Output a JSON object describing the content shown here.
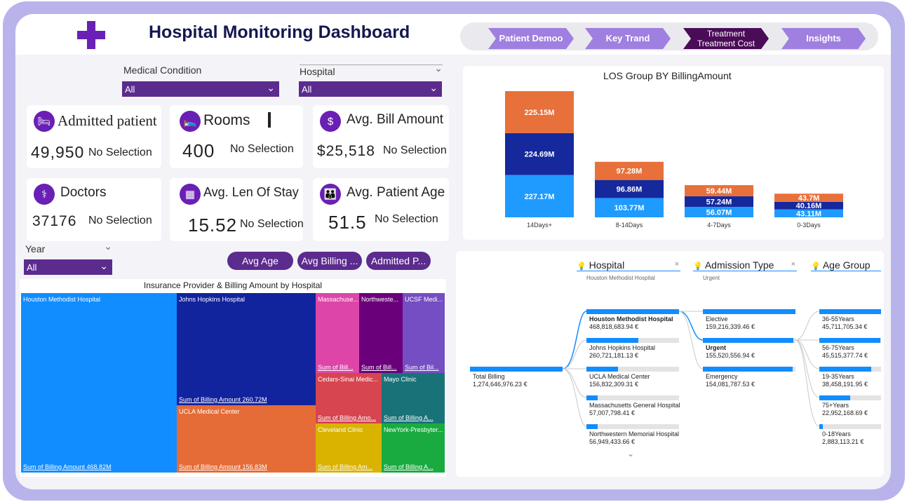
{
  "header": {
    "title": "Hospital Monitoring Dashboard",
    "nav": [
      {
        "label": "Patient Demoo"
      },
      {
        "label": "Key Trand"
      },
      {
        "label": "Treatment Treatment Cost"
      },
      {
        "label": "Insights"
      }
    ]
  },
  "filters": {
    "medical_condition": {
      "label": "Medical Condition",
      "value": "All"
    },
    "hospital": {
      "label": "Hospital",
      "value": "All"
    },
    "year": {
      "label": "Year",
      "value": "All"
    }
  },
  "kpis": {
    "admitted": {
      "title": "Admitted patient",
      "value": "49,950",
      "selection": "No Selection"
    },
    "rooms": {
      "title": "Rooms",
      "value": "400",
      "selection": "No Selection"
    },
    "avg_bill": {
      "title": "Avg. Bill Amount",
      "value": "$25,518",
      "selection": "No Selection"
    },
    "doctors": {
      "title": "Doctors",
      "value": "37176",
      "selection": "No Selection"
    },
    "avg_stay": {
      "title": "Avg. Len Of Stay",
      "value": "15.52",
      "selection": "No Selection"
    },
    "avg_age": {
      "title": "Avg. Patient Age",
      "value": "51.5",
      "selection": "No Selection"
    }
  },
  "buttons": {
    "avg_age": "Avg Age",
    "avg_billing": "Avg Billing ...",
    "admitted": "Admitted P..."
  },
  "chart_data": {
    "type": "bar",
    "title": "LOS Group BY BillingAmount",
    "categories": [
      "14Days+",
      "8-14Days",
      "4-7Days",
      "0-3Days"
    ],
    "series": [
      {
        "values": [
          227.17,
          103.77,
          56.07,
          43.11
        ],
        "labels": [
          "227.17M",
          "103.77M",
          "56.07M",
          "43.11M"
        ],
        "color": "#1f9bff"
      },
      {
        "values": [
          224.69,
          96.86,
          57.24,
          40.16
        ],
        "labels": [
          "224.69M",
          "96.86M",
          "57.24M",
          "40.16M"
        ],
        "color": "#15289c"
      },
      {
        "values": [
          225.15,
          97.28,
          59.44,
          43.7
        ],
        "labels": [
          "225.15M",
          "97.28M",
          "59.44M",
          "43.7M"
        ],
        "color": "#e8703a"
      }
    ],
    "stacked": true
  },
  "treemap": {
    "title": "Insurance Provider & Billing Amount by Hospital",
    "tiles": [
      {
        "name": "Houston Methodist Hospital",
        "value": "Sum of Billing Amount 468.82M",
        "color": "#118dff"
      },
      {
        "name": "Johns Hopkins Hospital",
        "value": "Sum of Billing Amount 260.72M",
        "color": "#12239e"
      },
      {
        "name": "UCLA Medical Center",
        "value": "Sum of Billing Amount 156.83M",
        "color": "#e66c37"
      },
      {
        "name": "Massachuse...",
        "value": "Sum of Bill...",
        "color": "#dd46a8"
      },
      {
        "name": "Northweste...",
        "value": "Sum of Bill...",
        "color": "#6b007b"
      },
      {
        "name": "UCSF Medi...",
        "value": "Sum of Bil...",
        "color": "#744ec2"
      },
      {
        "name": "Cedars-Sinai Medic...",
        "value": "Sum of Billing Amo...",
        "color": "#d64550"
      },
      {
        "name": "Mayo Clinic",
        "value": "Sum of Billing A...",
        "color": "#197278"
      },
      {
        "name": "Cleveland Clinic",
        "value": "Sum of Billing Am...",
        "color": "#d9b300"
      },
      {
        "name": "NewYork-Presbyter...",
        "value": "Sum of Billing A...",
        "color": "#1aab40"
      }
    ]
  },
  "decomp": {
    "levels": [
      {
        "label": "Hospital",
        "sub": "Houston Methodist Hospital"
      },
      {
        "label": "Admission Type",
        "sub": "Urgent"
      },
      {
        "label": "Age Group",
        "sub": ""
      }
    ],
    "root": {
      "name": "Total Billing",
      "value": "1,274,646,976.23 €"
    },
    "hospitals": [
      {
        "name": "Houston Methodist Hospital",
        "value": "468,818,683.94 €",
        "fill": 1.0
      },
      {
        "name": "Johns Hopkins Hospital",
        "value": "260,721,181.13 €",
        "fill": 0.56
      },
      {
        "name": "UCLA Medical Center",
        "value": "156,832,309.31 €",
        "fill": 0.34
      },
      {
        "name": "Massachusetts General Hospital",
        "value": "57,007,798.41 €",
        "fill": 0.12
      },
      {
        "name": "Northwestern Memorial Hospital",
        "value": "56,949,433.66 €",
        "fill": 0.12
      }
    ],
    "admission": [
      {
        "name": "Elective",
        "value": "159,216,339.46 €",
        "fill": 1.0
      },
      {
        "name": "Urgent",
        "value": "155,520,556.94 €",
        "fill": 0.98
      },
      {
        "name": "Emergency",
        "value": "154,081,787.53 €",
        "fill": 0.97
      }
    ],
    "age": [
      {
        "name": "36-55Years",
        "value": "45,711,705.34 €",
        "fill": 1.0
      },
      {
        "name": "56-75Years",
        "value": "45,515,377.74 €",
        "fill": 0.99
      },
      {
        "name": "19-35Years",
        "value": "38,458,191.95 €",
        "fill": 0.84
      },
      {
        "name": "75+Years",
        "value": "22,952,168.69 €",
        "fill": 0.5
      },
      {
        "name": "0-18Years",
        "value": "2,883,113.21 €",
        "fill": 0.06
      }
    ]
  }
}
